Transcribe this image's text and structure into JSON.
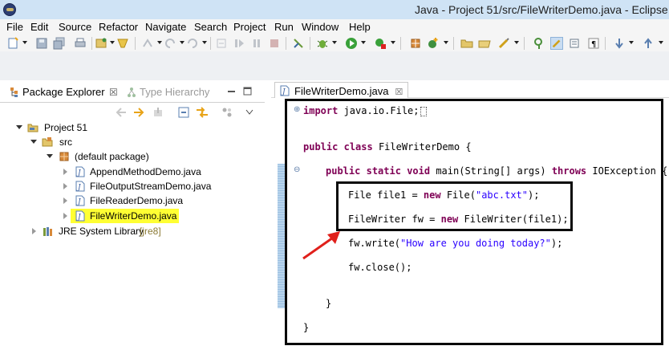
{
  "window": {
    "title": "Java - Project 51/src/FileWriterDemo.java - Eclipse"
  },
  "menu": [
    "File",
    "Edit",
    "Source",
    "Refactor",
    "Navigate",
    "Search",
    "Project",
    "Run",
    "Window",
    "Help"
  ],
  "package_explorer": {
    "tab_label": "Package Explorer",
    "tab_close": "☒",
    "other_tab": "Type Hierarchy",
    "tree": {
      "project": "Project 51",
      "src": "src",
      "package": "(default package)",
      "files": [
        "AppendMethodDemo.java",
        "FileOutputStreamDemo.java",
        "FileReaderDemo.java",
        "FileWriterDemo.java"
      ],
      "selected_file": "FileWriterDemo.java",
      "jre_label": "JRE System Library",
      "jre_version": "[jre8]"
    }
  },
  "editor": {
    "tab_label": "FileWriterDemo.java",
    "tab_close": "☒",
    "code": {
      "import_kw": "import",
      "import_rest": " java.io.File;",
      "class_public": "public",
      "class_kw": "class",
      "class_name": " FileWriterDemo {",
      "method_public": "public",
      "method_static": "static",
      "method_void": "void",
      "method_sig": " main(String[] args) ",
      "method_throws": "throws",
      "method_exc": " IOException {",
      "l1_a": "File file1 = ",
      "l1_new": "new",
      "l1_b": " File(",
      "l1_str": "\"abc.txt\"",
      "l1_c": ");",
      "l2_a": "FileWriter fw = ",
      "l2_new": "new",
      "l2_b": " FileWriter(file1);",
      "l3_a": "fw.write(",
      "l3_str": "\"How are you doing today?\"",
      "l3_b": ");",
      "l4": "fw.close();",
      "close_method": "}",
      "close_class": "}"
    }
  },
  "colors": {
    "keyword": "#7f0055",
    "string": "#2a00ff",
    "highlight": "#ffff33",
    "arrow": "#e0201b"
  }
}
